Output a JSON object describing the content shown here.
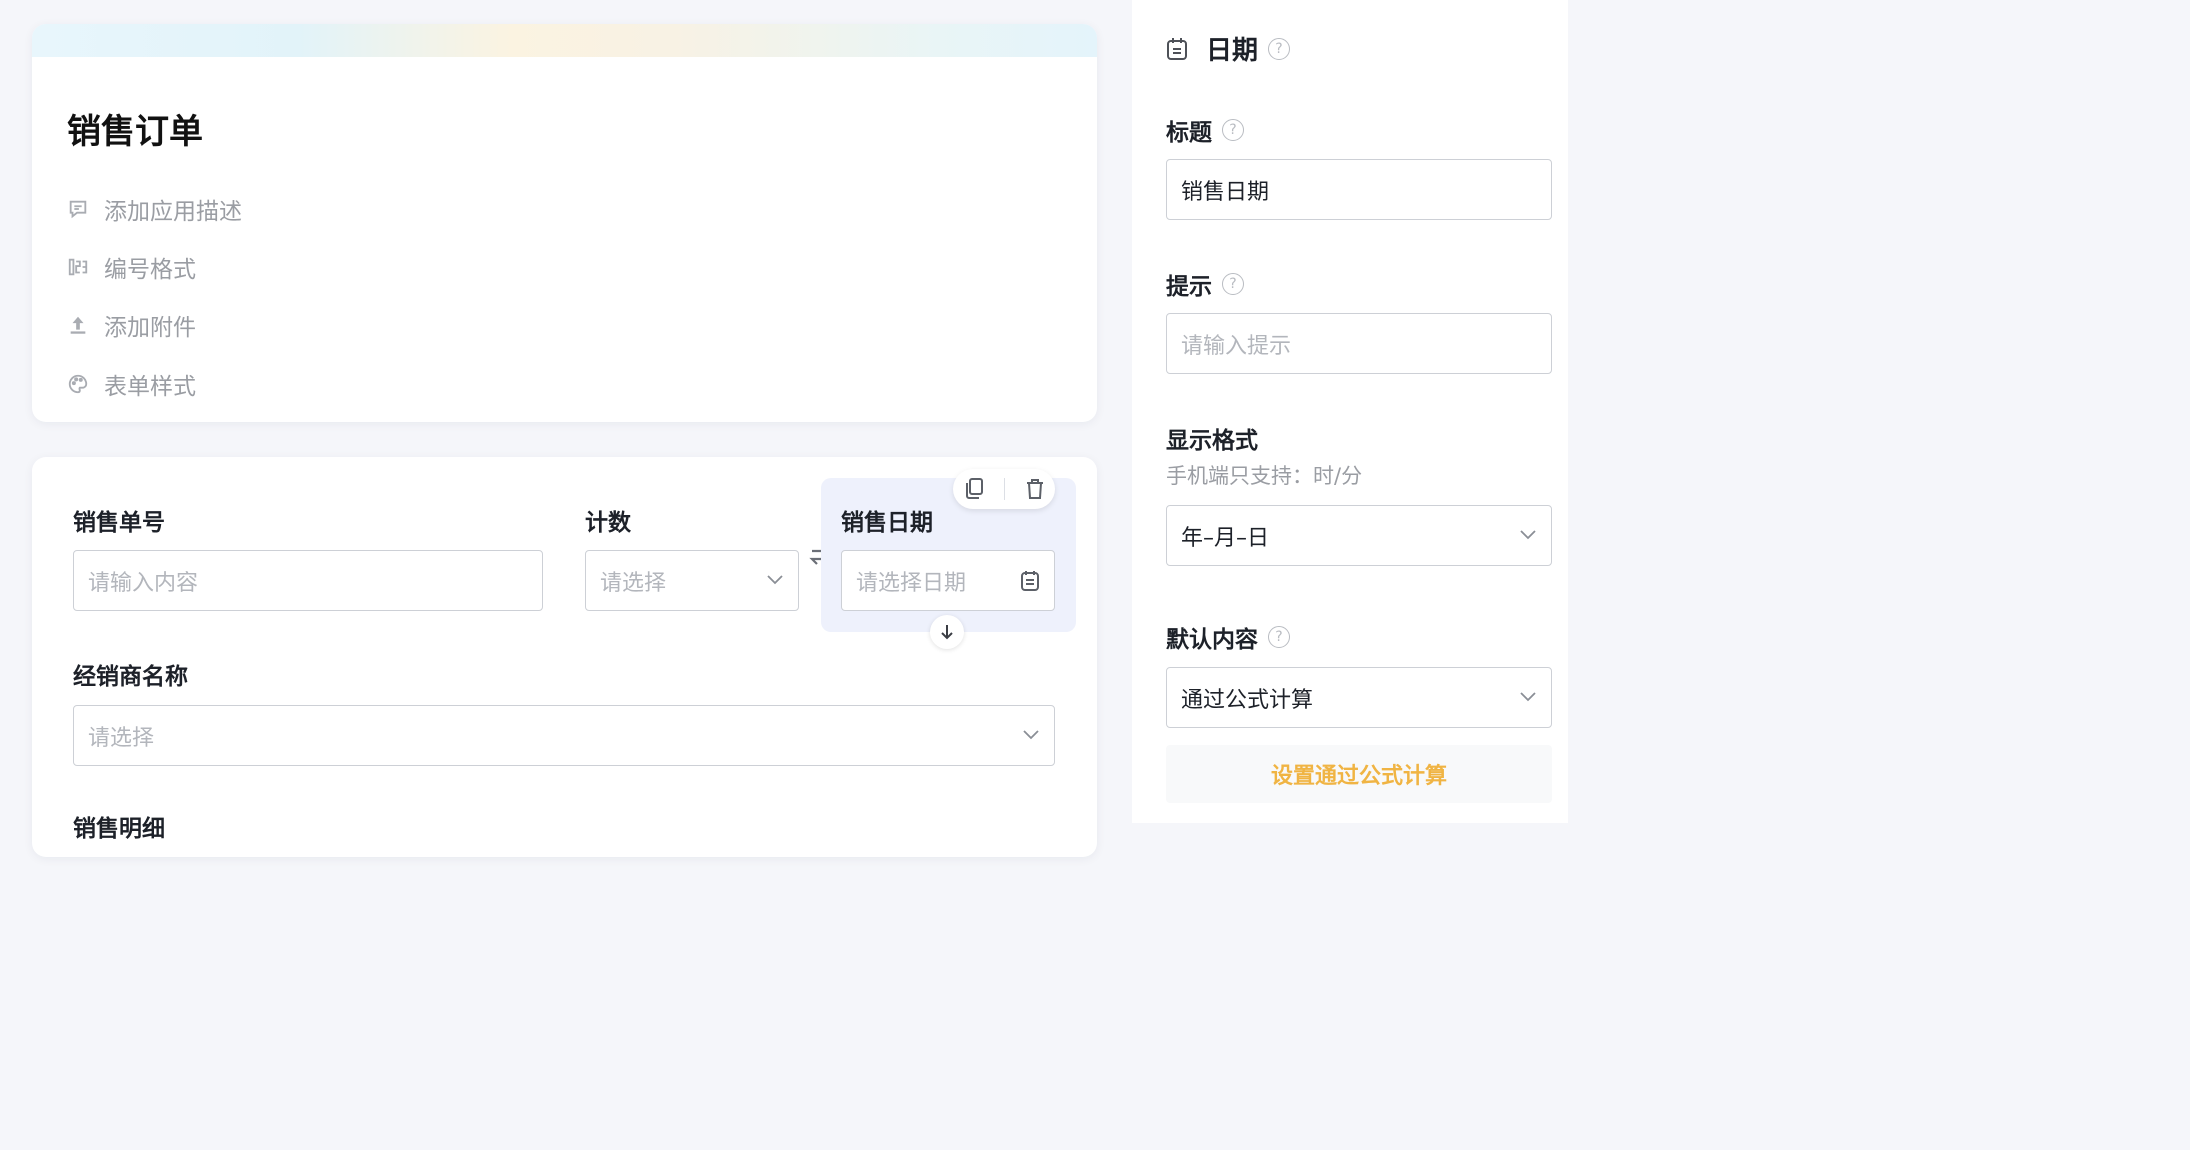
{
  "form": {
    "title": "销售订单",
    "header_items": [
      {
        "label": "添加应用描述",
        "icon": "comment-icon"
      },
      {
        "label": "编号格式",
        "icon": "numbering-icon"
      },
      {
        "label": "添加附件",
        "icon": "upload-icon"
      },
      {
        "label": "表单样式",
        "icon": "palette-icon"
      }
    ]
  },
  "fields": {
    "order_no": {
      "label": "销售单号",
      "placeholder": "请输入内容"
    },
    "count": {
      "label": "计数",
      "placeholder": "请选择"
    },
    "sale_date": {
      "label": "销售日期",
      "placeholder": "请选择日期"
    },
    "dealer": {
      "label": "经销商名称",
      "placeholder": "请选择"
    },
    "details": {
      "label": "销售明细"
    }
  },
  "panel": {
    "header_title": "日期",
    "title_label": "标题",
    "title_value": "销售日期",
    "hint_label": "提示",
    "hint_placeholder": "请输入提示",
    "format_label": "显示格式",
    "format_note": "手机端只支持：时/分",
    "format_value": "年–月–日",
    "default_label": "默认内容",
    "default_value": "通过公式计算",
    "formula_button": "设置通过公式计算"
  },
  "colors": {
    "accent_orange": "#f0b443",
    "selected_bg": "#eef1fc",
    "border": "#cdd0d6"
  }
}
